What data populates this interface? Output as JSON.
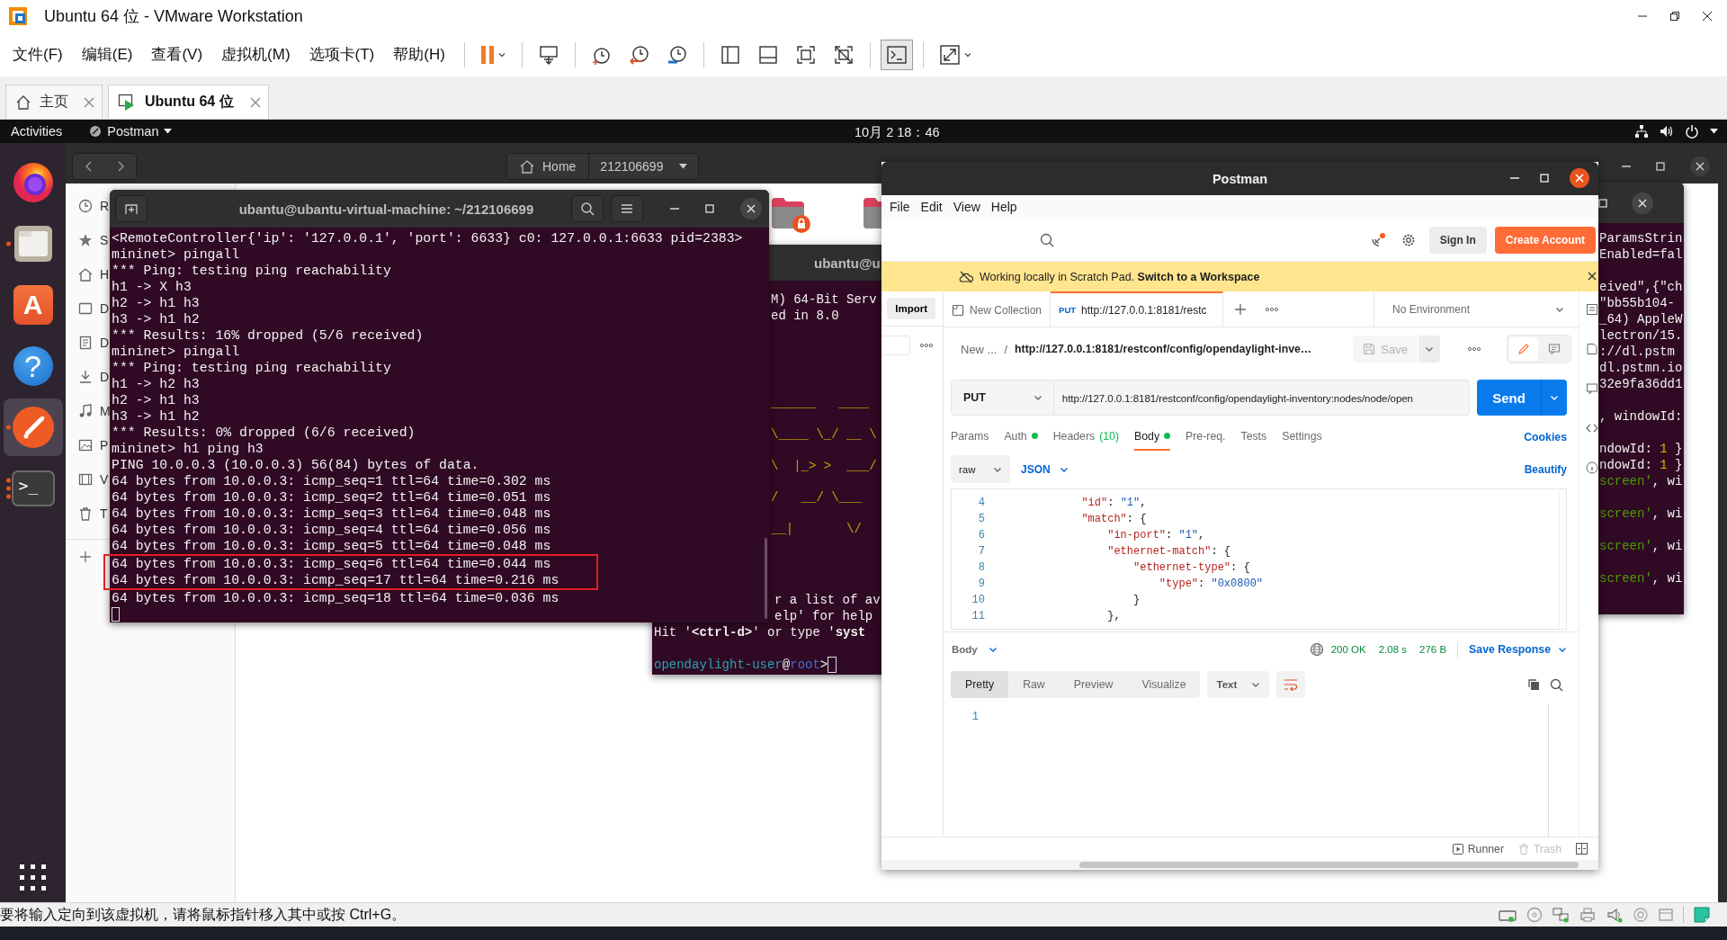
{
  "vmware": {
    "title": "Ubuntu 64 位 - VMware Workstation",
    "menu": [
      "文件(F)",
      "编辑(E)",
      "查看(V)",
      "虚拟机(M)",
      "选项卡(T)",
      "帮助(H)"
    ],
    "toolbar": [
      {
        "kind": "pause",
        "pressed": false
      },
      {
        "kind": "send-keys",
        "pressed": false
      },
      {
        "kind": "snapshot-take",
        "pressed": false
      },
      {
        "kind": "snapshot-revert",
        "pressed": false
      },
      {
        "kind": "snapshot-manager",
        "pressed": false
      },
      {
        "kind": "view-sidebar",
        "pressed": false
      },
      {
        "kind": "view-thumbnail",
        "pressed": false
      },
      {
        "kind": "fit-guest",
        "pressed": false
      },
      {
        "kind": "unity",
        "pressed": false
      },
      {
        "kind": "console",
        "pressed": true
      },
      {
        "kind": "stretch",
        "pressed": false
      }
    ],
    "tabs": [
      {
        "kind": "home",
        "label": "主页",
        "selected": false
      },
      {
        "kind": "vm",
        "label": "Ubuntu 64 位",
        "selected": true
      }
    ],
    "status_text": "要将输入定向到该虚拟机，请将鼠标指针移入其中或按 Ctrl+G。"
  },
  "ubuntu": {
    "topbar": {
      "activities": "Activities",
      "app": "Postman",
      "clock": "10月 2  18：46"
    },
    "dock": [
      {
        "kind": "browser",
        "running": false,
        "selected": false
      },
      {
        "kind": "files",
        "running": true,
        "selected": false
      },
      {
        "kind": "software",
        "glyph": "A",
        "running": false,
        "selected": false
      },
      {
        "kind": "help",
        "glyph": "?",
        "running": false,
        "selected": false
      },
      {
        "kind": "postman",
        "running": true,
        "selected": true
      },
      {
        "kind": "terminal",
        "glyph": ">_",
        "running": true,
        "selected": false
      }
    ],
    "files": {
      "path": "Home",
      "folder": "212106699",
      "sidebar": [
        {
          "kind": "recent",
          "label": "R"
        },
        {
          "kind": "starred",
          "label": "S"
        },
        {
          "kind": "home",
          "label": "H"
        },
        {
          "kind": "desktop",
          "label": "D"
        },
        {
          "kind": "documents",
          "label": "D"
        },
        {
          "kind": "downloads",
          "label": "D"
        },
        {
          "kind": "music",
          "label": "M"
        },
        {
          "kind": "pictures",
          "label": "P"
        },
        {
          "kind": "videos",
          "label": "V"
        },
        {
          "kind": "trash",
          "label": "T"
        }
      ],
      "folders": [
        {
          "locked": true
        },
        {
          "locked": false
        }
      ]
    },
    "terminal_main": {
      "title": "ubantu@ubantu-virtual-machine: ~/212106699",
      "lines": [
        {
          "text": "<RemoteController{'ip': '127.0.0.1', 'port': 6633} c0: 127.0.0.1:6633 pid=2383>",
          "highlighted": false
        },
        {
          "text": "mininet> pingall",
          "highlighted": false
        },
        {
          "text": "*** Ping: testing ping reachability",
          "highlighted": false
        },
        {
          "text": "h1 -> X h3",
          "highlighted": false
        },
        {
          "text": "h2 -> h1 h3",
          "highlighted": false
        },
        {
          "text": "h3 -> h1 h2",
          "highlighted": false
        },
        {
          "text": "*** Results: 16% dropped (5/6 received)",
          "highlighted": false
        },
        {
          "text": "mininet> pingall",
          "highlighted": false
        },
        {
          "text": "*** Ping: testing ping reachability",
          "highlighted": false
        },
        {
          "text": "h1 -> h2 h3",
          "highlighted": false
        },
        {
          "text": "h2 -> h1 h3",
          "highlighted": false
        },
        {
          "text": "h3 -> h1 h2",
          "highlighted": false
        },
        {
          "text": "*** Results: 0% dropped (6/6 received)",
          "highlighted": false
        },
        {
          "text": "mininet> h1 ping h3",
          "highlighted": false
        },
        {
          "text": "PING 10.0.0.3 (10.0.0.3) 56(84) bytes of data.",
          "highlighted": false
        },
        {
          "text": "64 bytes from 10.0.0.3: icmp_seq=1 ttl=64 time=0.302 ms",
          "highlighted": false
        },
        {
          "text": "64 bytes from 10.0.0.3: icmp_seq=2 ttl=64 time=0.051 ms",
          "highlighted": false
        },
        {
          "text": "64 bytes from 10.0.0.3: icmp_seq=3 ttl=64 time=0.048 ms",
          "highlighted": false
        },
        {
          "text": "64 bytes from 10.0.0.3: icmp_seq=4 ttl=64 time=0.056 ms",
          "highlighted": false
        },
        {
          "text": "64 bytes from 10.0.0.3: icmp_seq=5 ttl=64 time=0.048 ms",
          "highlighted": false
        },
        {
          "text": "64 bytes from 10.0.0.3: icmp_seq=6 ttl=64 time=0.044 ms",
          "highlighted": true
        },
        {
          "text": "64 bytes from 10.0.0.3: icmp_seq=17 ttl=64 time=0.216 ms",
          "highlighted": true
        },
        {
          "text": "64 bytes from 10.0.0.3: icmp_seq=18 ttl=64 time=0.036 ms",
          "highlighted": false
        }
      ]
    },
    "terminal_odl": {
      "title": "ubantu@u",
      "header_lines": [
        "M) 64-Bit Serv",
        "ed in 8.0"
      ],
      "banner": [
        "______   ____",
        "\\____ \\_/ __ \\",
        "\\  |_> >  ___/",
        "/   __/ \\___",
        "__|       \\/"
      ],
      "help_lines": [
        "r a list of av",
        "elp' for help"
      ],
      "hint": "Hit '**<ctrl-d>**' or type '**syst**",
      "prompt": [
        {
          "kind": "user",
          "text": "opendaylight-user"
        },
        {
          "kind": "plain",
          "text": "@"
        },
        {
          "kind": "host",
          "text": "root"
        },
        {
          "kind": "plain",
          "text": ">"
        }
      ]
    },
    "terminal_right": {
      "lines": [
        {
          "spaced": false,
          "tokens": [
            {
              "kind": "plain",
              "text": "ParamsStrin"
            }
          ]
        },
        {
          "spaced": false,
          "tokens": [
            {
              "kind": "plain",
              "text": "Enabled=fal"
            }
          ]
        },
        {
          "spaced": true,
          "tokens": [
            {
              "kind": "plain",
              "text": "eived\",{\"ch"
            }
          ]
        },
        {
          "spaced": false,
          "tokens": [
            {
              "kind": "plain",
              "text": "\"bb55b104-"
            }
          ]
        },
        {
          "spaced": false,
          "tokens": [
            {
              "kind": "plain",
              "text": "_64) AppleW"
            }
          ]
        },
        {
          "spaced": false,
          "tokens": [
            {
              "kind": "plain",
              "text": "lectron/15."
            }
          ]
        },
        {
          "spaced": false,
          "tokens": [
            {
              "kind": "plain",
              "text": "://dl.pstm"
            }
          ]
        },
        {
          "spaced": false,
          "tokens": [
            {
              "kind": "plain",
              "text": "dl.pstmn.io"
            }
          ]
        },
        {
          "spaced": false,
          "tokens": [
            {
              "kind": "plain",
              "text": "32e9fa36dd1"
            }
          ]
        },
        {
          "spaced": true,
          "tokens": [
            {
              "kind": "plain",
              "text": ", windowId:"
            }
          ]
        },
        {
          "spaced": true,
          "tokens": [
            {
              "kind": "plain",
              "text": "ndowId: "
            },
            {
              "kind": "number",
              "text": "1"
            },
            {
              "kind": "plain",
              "text": " }"
            }
          ]
        },
        {
          "spaced": false,
          "tokens": [
            {
              "kind": "plain",
              "text": "ndowId: "
            },
            {
              "kind": "number",
              "text": "1"
            },
            {
              "kind": "plain",
              "text": " }"
            }
          ]
        },
        {
          "spaced": false,
          "tokens": [
            {
              "kind": "string",
              "text": "screen'"
            },
            {
              "kind": "plain",
              "text": ", wi"
            }
          ]
        },
        {
          "spaced": true,
          "tokens": [
            {
              "kind": "string",
              "text": "screen'"
            },
            {
              "kind": "plain",
              "text": ", wi"
            }
          ]
        },
        {
          "spaced": true,
          "tokens": [
            {
              "kind": "string",
              "text": "screen'"
            },
            {
              "kind": "plain",
              "text": ", wi"
            }
          ]
        },
        {
          "spaced": true,
          "tokens": [
            {
              "kind": "string",
              "text": "screen'"
            },
            {
              "kind": "plain",
              "text": ", wi"
            }
          ]
        }
      ]
    },
    "postman": {
      "title": "Postman",
      "menu": [
        "File",
        "Edit",
        "View",
        "Help"
      ],
      "sign_in": "Sign In",
      "create_account": "Create Account",
      "banner": "Working locally in Scratch Pad. **Switch to a Workspace**",
      "import": "Import",
      "tabs": [
        {
          "kind": "collection",
          "label": "New Collection",
          "selected": false
        },
        {
          "kind": "request",
          "method": "PUT",
          "label": "http://127.0.0.1:8181/restc",
          "selected": true
        }
      ],
      "environment": "No Environment",
      "breadcrumb": {
        "parent": "New ...",
        "separator": "/",
        "name": "http://127.0.0.1:8181/restconf/config/opendaylight-inve…"
      },
      "save": {
        "label": "Save",
        "disabled": true
      },
      "method": "PUT",
      "url": "http://127.0.0.1:8181/restconf/config/opendaylight-inventory:nodes/node/open",
      "send": "Send",
      "request_tabs": [
        {
          "label": "Params",
          "dot": false,
          "selected": false
        },
        {
          "label": "Auth",
          "dot": true,
          "selected": false
        },
        {
          "label": "Headers",
          "count": "(10)",
          "dot": false,
          "selected": false
        },
        {
          "label": "Body",
          "dot": true,
          "selected": true
        },
        {
          "label": "Pre-req.",
          "dot": false,
          "selected": false
        },
        {
          "label": "Tests",
          "dot": false,
          "selected": false
        },
        {
          "label": "Settings",
          "dot": false,
          "selected": false
        }
      ],
      "cookies": "Cookies",
      "body_mode": "raw",
      "body_language": "JSON",
      "beautify": "Beautify",
      "code": [
        {
          "number": "4",
          "tokens": [
            {
              "kind": "key",
              "text": "            \"id\""
            },
            {
              "kind": "punct",
              "text": ": "
            },
            {
              "kind": "string",
              "text": "\"1\""
            },
            {
              "kind": "punct",
              "text": ","
            }
          ]
        },
        {
          "number": "5",
          "tokens": [
            {
              "kind": "key",
              "text": "            \"match\""
            },
            {
              "kind": "punct",
              "text": ": {"
            }
          ]
        },
        {
          "number": "6",
          "tokens": [
            {
              "kind": "key",
              "text": "                \"in-port\""
            },
            {
              "kind": "punct",
              "text": ": "
            },
            {
              "kind": "string",
              "text": "\"1\""
            },
            {
              "kind": "punct",
              "text": ","
            }
          ]
        },
        {
          "number": "7",
          "tokens": [
            {
              "kind": "key",
              "text": "                \"ethernet-match\""
            },
            {
              "kind": "punct",
              "text": ": {"
            }
          ]
        },
        {
          "number": "8",
          "tokens": [
            {
              "kind": "key",
              "text": "                    \"ethernet-type\""
            },
            {
              "kind": "punct",
              "text": ": {"
            }
          ]
        },
        {
          "number": "9",
          "tokens": [
            {
              "kind": "key",
              "text": "                        \"type\""
            },
            {
              "kind": "punct",
              "text": ": "
            },
            {
              "kind": "string",
              "text": "\"0x0800\""
            }
          ]
        },
        {
          "number": "10",
          "tokens": [
            {
              "kind": "punct",
              "text": "                    }"
            }
          ]
        },
        {
          "number": "11",
          "tokens": [
            {
              "kind": "punct",
              "text": "                },"
            }
          ]
        }
      ],
      "response": {
        "label": "Body",
        "status": "200 OK",
        "time": "2.08 s",
        "size": "276 B",
        "save": "Save Response",
        "views": [
          {
            "label": "Pretty",
            "selected": true
          },
          {
            "label": "Raw",
            "selected": false
          },
          {
            "label": "Preview",
            "selected": false
          },
          {
            "label": "Visualize",
            "selected": false
          }
        ],
        "format": "Text",
        "wrap": true,
        "line_numbers": [
          "1"
        ]
      },
      "footer": [
        {
          "kind": "runner",
          "label": "Runner",
          "disabled": false
        },
        {
          "kind": "trash",
          "label": "Trash",
          "disabled": true
        }
      ]
    }
  }
}
